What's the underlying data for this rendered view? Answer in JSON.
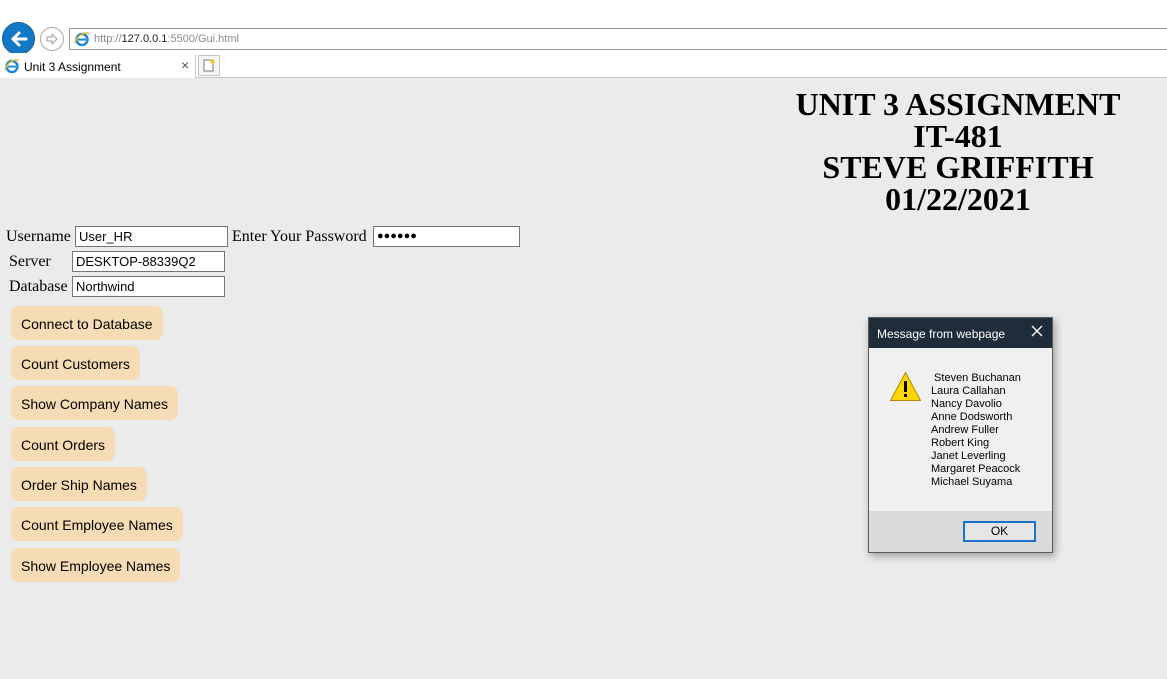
{
  "browser": {
    "url_prefix": "http://",
    "url_host": "127.0.0.1",
    "url_rest": ":5500/Gui.html",
    "tab_title": "Unit 3 Assignment",
    "tab_close": "×"
  },
  "header": {
    "line1": "UNIT 3 ASSIGNMENT",
    "line2": "IT-481",
    "line3": "STEVE GRIFFITH",
    "line4": "01/22/2021"
  },
  "form": {
    "username_label": "Username",
    "username_value": "User_HR",
    "password_label": "Enter Your Password",
    "password_value": "●●●●●●",
    "server_label": "Server",
    "server_value": "DESKTOP-88339Q2",
    "database_label": "Database",
    "database_value": "Northwind"
  },
  "buttons": [
    {
      "label": "Connect to Database"
    },
    {
      "label": "Count Customers"
    },
    {
      "label": "Show Company Names"
    },
    {
      "label": "Count Orders"
    },
    {
      "label": "Order Ship Names"
    },
    {
      "label": "Count Employee Names"
    },
    {
      "label": "Show Employee Names"
    }
  ],
  "dialog": {
    "title": "Message from webpage",
    "message": " Steven Buchanan\nLaura Callahan\nNancy Davolio\nAnne Dodsworth\nAndrew Fuller\nRobert King\nJanet Leverling\nMargaret Peacock\nMichael Suyama",
    "ok_label": "OK"
  },
  "colors": {
    "page_bg": "#ebebeb",
    "button_bg": "#f6dcb5",
    "dialog_titlebar": "#1f2d3a",
    "accent_blue": "#1479c4"
  }
}
